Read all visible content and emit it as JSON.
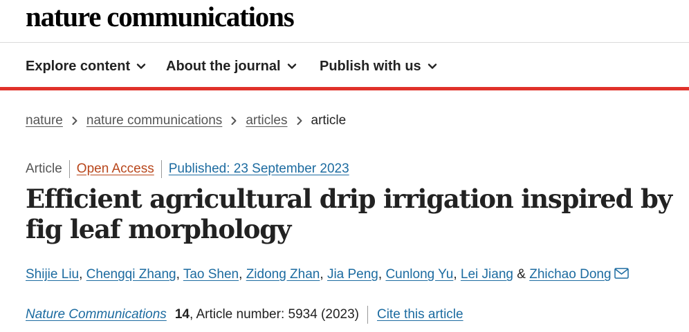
{
  "header": {
    "logo_text": "nature communications"
  },
  "nav": {
    "items": [
      {
        "label": "Explore content",
        "icon": "chevron-down-icon"
      },
      {
        "label": "About the journal",
        "icon": "chevron-down-icon"
      },
      {
        "label": "Publish with us",
        "icon": "chevron-down-icon"
      }
    ],
    "accent_color": "#e0312b"
  },
  "breadcrumb": {
    "items": [
      "nature",
      "nature communications",
      "articles"
    ],
    "current": "article"
  },
  "article": {
    "type": "Article",
    "access": "Open Access",
    "published": "Published: 23 September 2023",
    "title": "Efficient agricultural drip irrigation inspired by fig leaf morphology",
    "authors": [
      "Shijie Liu",
      "Chengqi Zhang",
      "Tao Shen",
      "Zidong Zhan",
      "Jia Peng",
      "Cunlong Yu",
      "Lei Jiang",
      "Zhichao Dong"
    ],
    "author_separator": ", ",
    "author_final_separator": " & ",
    "contact_icon": "mail-icon"
  },
  "citation": {
    "journal": "Nature Communications",
    "volume": "14",
    "rest": ", Article number: 5934 (2023)",
    "cite_label": "Cite this article"
  },
  "colors": {
    "link": "#1c6ba0",
    "open_access": "#b8461b",
    "text": "#222222"
  }
}
